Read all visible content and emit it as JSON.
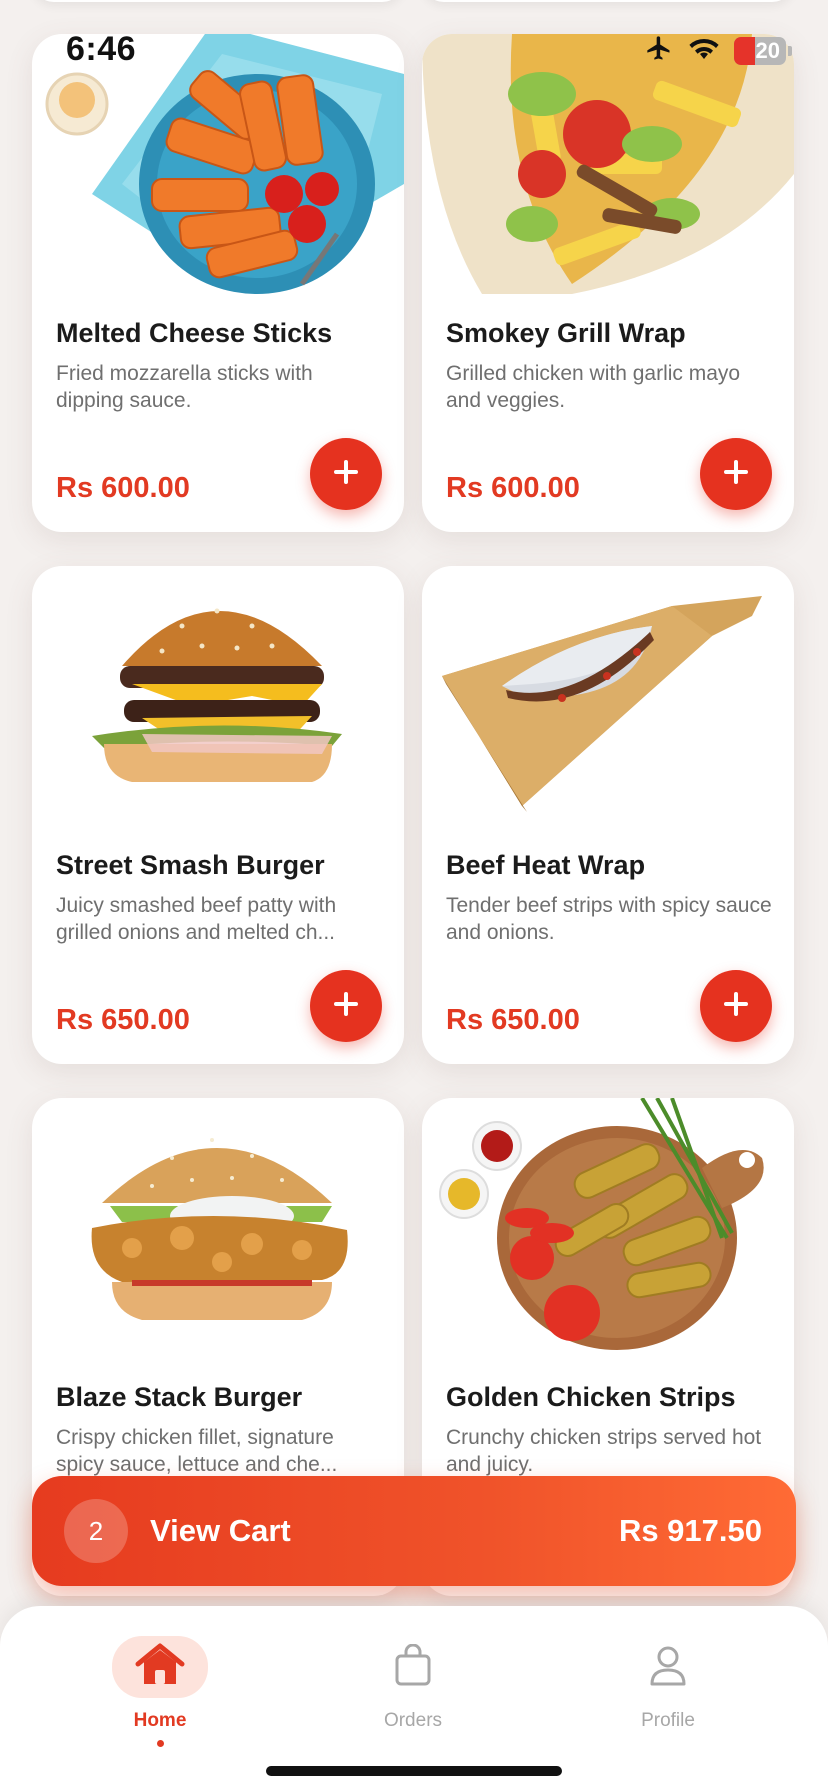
{
  "status_bar": {
    "time": "6:46",
    "battery": "20"
  },
  "menu": {
    "items": [
      {
        "name": "Melted Cheese Sticks",
        "description": "Fried mozzarella sticks with dipping sauce.",
        "price": "Rs 600.00",
        "image": "cheese-sticks-image"
      },
      {
        "name": "Smokey Grill Wrap",
        "description": "Grilled chicken with garlic mayo and veggies.",
        "price": "Rs 600.00",
        "image": "grill-wrap-image"
      },
      {
        "name": "Street Smash Burger",
        "description_line1": "Juicy smashed beef patty with",
        "description_line2": "grilled onions and melted ch...",
        "price": "Rs 650.00",
        "image": "smash-burger-image"
      },
      {
        "name": "Beef Heat Wrap",
        "description": "Tender beef strips with spicy sauce and onions.",
        "price": "Rs 650.00",
        "image": "beef-wrap-image"
      },
      {
        "name": "Blaze Stack Burger",
        "description_line1": "Crispy chicken fillet, signature",
        "description_line2": "spicy sauce, lettuce and che...",
        "price": "",
        "image": "chicken-burger-image"
      },
      {
        "name": "Golden Chicken Strips",
        "description": "Crunchy chicken strips served hot and juicy.",
        "price": "",
        "image": "chicken-strips-image"
      }
    ]
  },
  "cart": {
    "count": "2",
    "label": "View Cart",
    "total": "Rs 917.50"
  },
  "tabs": [
    {
      "label": "Home",
      "icon": "home-icon",
      "active": true
    },
    {
      "label": "Orders",
      "icon": "bag-icon",
      "active": false
    },
    {
      "label": "Profile",
      "icon": "user-icon",
      "active": false
    }
  ],
  "colors": {
    "accent": "#e5321f",
    "price": "#e23a22",
    "active_tab_bg": "#fde3dc"
  }
}
